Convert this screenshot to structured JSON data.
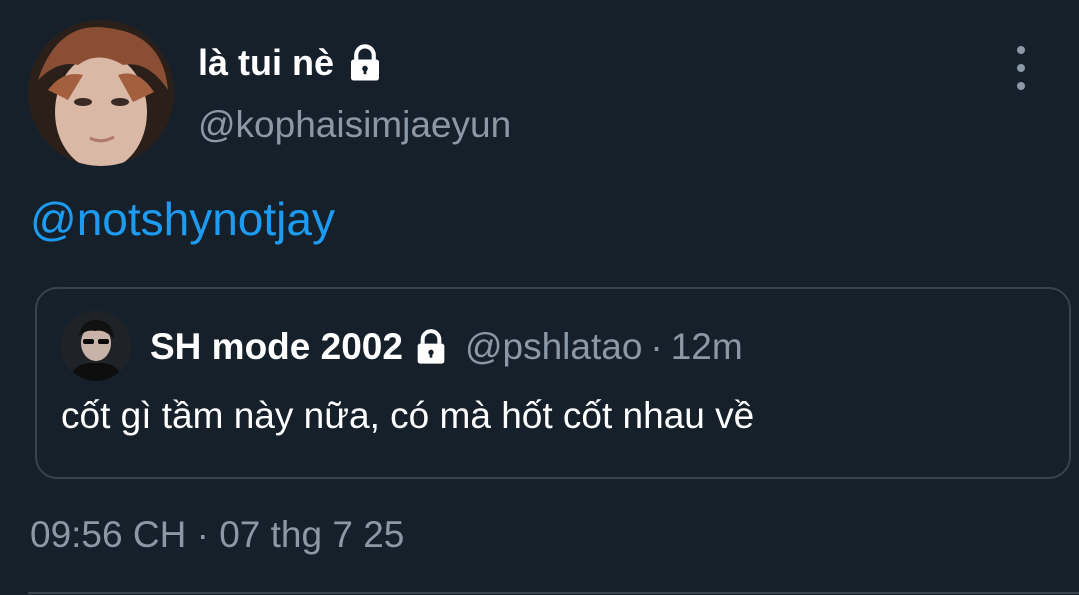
{
  "tweet": {
    "author": {
      "display_name": "là tui nè",
      "handle": "@kophaisimjaeyun",
      "protected": true,
      "avatar": "avatar-photo"
    },
    "more_icon": "more-vertical-icon",
    "mention": "@notshynotjay",
    "quote": {
      "author": {
        "display_name": "SH mode 2002",
        "handle": "@pshlatao",
        "protected": true,
        "avatar": "avatar-photo"
      },
      "separator": "·",
      "time": "12m",
      "text": "cốt gì tầm này nữa, có mà hốt cốt nhau về"
    },
    "timestamp": "09:56 CH · 07 thg 7 25"
  },
  "colors": {
    "background": "#15202b",
    "primary_text": "#ffffff",
    "secondary_text": "#8b98a5",
    "link": "#1d9bf0",
    "border": "#38444d"
  }
}
